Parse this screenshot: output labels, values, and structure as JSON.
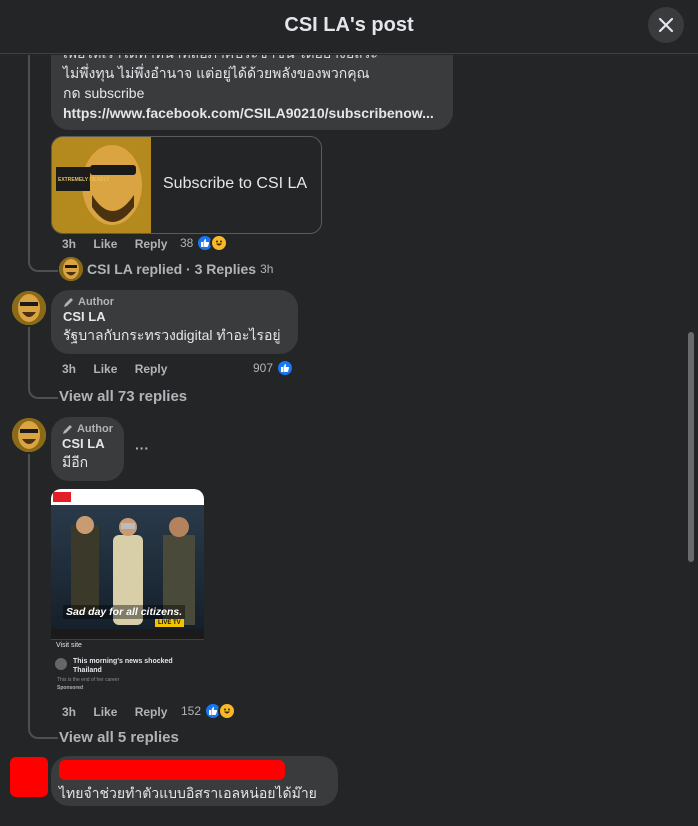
{
  "header": {
    "title": "CSI LA's post",
    "close_icon": "close-icon"
  },
  "comment1": {
    "text_line1": "เพื่อให้เราได้ทำหน้าที่สื่อภาคประชาชน ได้อย่างอิสระ",
    "text_line2": "ไม่พึ่งทุน ไม่พึ่งอำนาจ แต่อยู่ได้ด้วยพลังของพวกคุณ",
    "text_line3": "กด subscribe",
    "link": "https://www.facebook.com/CSILA90210/subscribenow...",
    "card_label": "Subscribe to CSI LA",
    "card_image_text": "EXTREMELY DEADLY",
    "time": "3h",
    "like": "Like",
    "reply": "Reply",
    "reaction_count": "38",
    "replied_text": "CSI LA replied · 3 Replies",
    "replied_time": "3h"
  },
  "comment2": {
    "author_tag": "Author",
    "name": "CSI LA",
    "text": "รัฐบาลกับกระทรวงdigital ทำอะไรอยู่",
    "time": "3h",
    "like": "Like",
    "reply": "Reply",
    "reaction_count": "907",
    "view_all": "View all 73 replies"
  },
  "comment3": {
    "author_tag": "Author",
    "name": "CSI LA",
    "text": "มีอีก",
    "more": "···",
    "ad_banner": "Sad day for all citizens.",
    "ad_badge": "LIVE TV",
    "ad_visit": "Visit site",
    "ad_title": "This morning's news shocked Thailand",
    "ad_sub": "This is the end of her career",
    "ad_sponsored": "Sponsored",
    "time": "3h",
    "like": "Like",
    "reply": "Reply",
    "reaction_count": "152",
    "view_all": "View all 5 replies"
  },
  "comment4": {
    "text": "ไทยจำช่วยทำตัวแบบอิสราเอลหน่อยได้ม๊าย"
  },
  "colors": {
    "background": "#242526",
    "bubble": "#3a3b3c",
    "like_blue": "#1877f2",
    "redact": "#ff0000"
  }
}
